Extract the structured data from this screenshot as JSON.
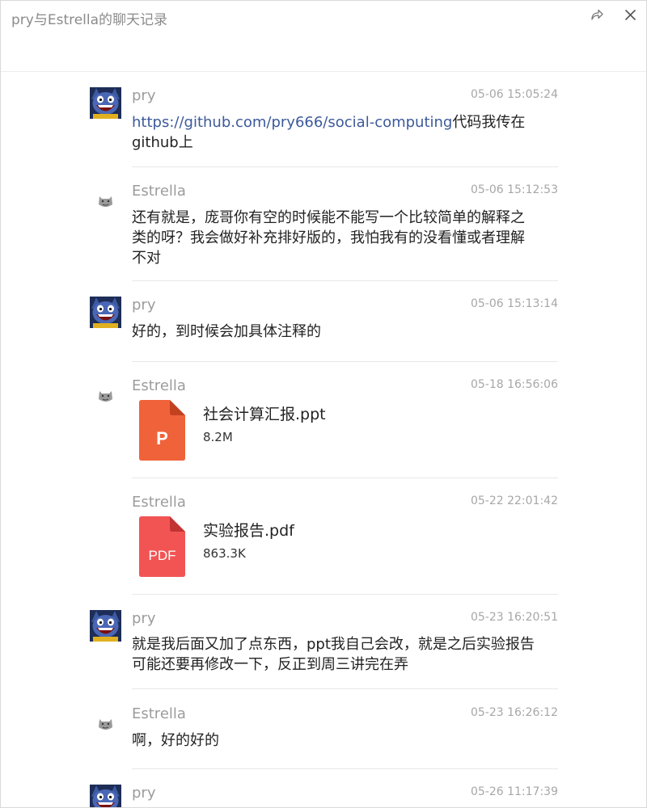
{
  "window": {
    "title": "pry与Estrella的聊天记录"
  },
  "messages": [
    {
      "sender": "pry",
      "time": "05-06 15:05:24",
      "link": "https://github.com/pry666/social-computing",
      "text_after_link": "代码我传在",
      "text_line2": "github上"
    },
    {
      "sender": "Estrella",
      "time": "05-06 15:12:53",
      "lines": [
        "还有就是，庞哥你有空的时候能不能写一个比较简单的解释之",
        "类的呀？我会做好补充排好版的，我怕我有的没看懂或者理解",
        "不对"
      ]
    },
    {
      "sender": "pry",
      "time": "05-06 15:13:14",
      "text": "好的，到时候会加具体注释的"
    },
    {
      "sender": "Estrella",
      "time": "05-18 16:56:06",
      "file": {
        "name": "社会计算汇报.ppt",
        "size": "8.2M",
        "icon": "ppt-file-icon",
        "icon_label": "P",
        "color": "#f0633a"
      }
    },
    {
      "sender": "Estrella",
      "time": "05-22 22:01:42",
      "file": {
        "name": "实验报告.pdf",
        "size": "863.3K",
        "icon": "pdf-file-icon",
        "icon_label": "PDF",
        "color": "#f25454"
      }
    },
    {
      "sender": "pry",
      "time": "05-23 16:20:51",
      "lines": [
        "就是我后面又加了点东西，ppt我自己会改，就是之后实验报告",
        "可能还要再修改一下，反正到周三讲完在弄"
      ]
    },
    {
      "sender": "Estrella",
      "time": "05-23 16:26:12",
      "text": "啊，好的好的"
    },
    {
      "sender": "pry",
      "time": "05-26 11:17:39"
    }
  ],
  "icons": {
    "share": "share-icon",
    "close": "close-icon"
  },
  "colors": {
    "link": "#3c5a9a",
    "timestamp": "#a7a7a7",
    "sender": "#9c9c9c"
  }
}
